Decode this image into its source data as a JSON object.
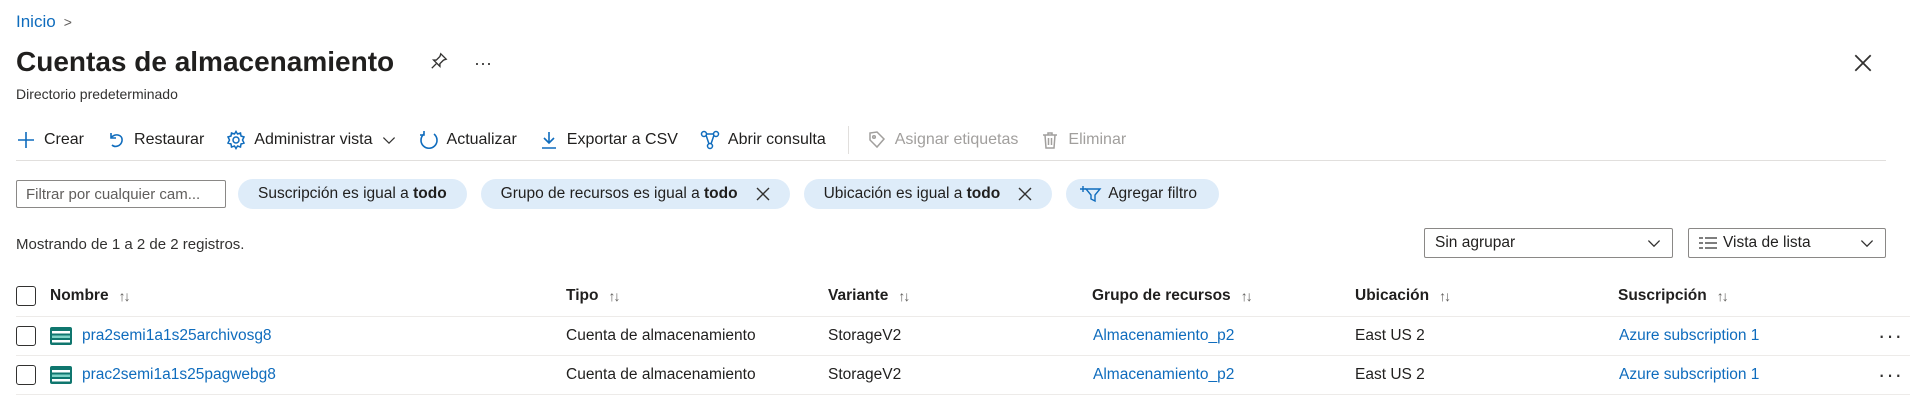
{
  "breadcrumb": {
    "home": "Inicio"
  },
  "page": {
    "title": "Cuentas de almacenamiento",
    "subtitle": "Directorio predeterminado"
  },
  "commands": {
    "crear": "Crear",
    "restaurar": "Restaurar",
    "administrar_vista": "Administrar vista",
    "actualizar": "Actualizar",
    "exportar": "Exportar a CSV",
    "abrir_consulta": "Abrir consulta",
    "asignar_etiquetas": "Asignar etiquetas",
    "eliminar": "Eliminar"
  },
  "filters": {
    "search_placeholder": "Filtrar por cualquier cam...",
    "pills": [
      {
        "prefix": "Suscripción es igual a ",
        "value": "todo"
      },
      {
        "prefix": "Grupo de recursos es igual a ",
        "value": "todo"
      },
      {
        "prefix": "Ubicación es igual a ",
        "value": "todo"
      }
    ],
    "add_filter": "Agregar filtro"
  },
  "records_text": "Mostrando de 1 a 2 de 2 registros.",
  "grouping": {
    "selected": "Sin agrupar"
  },
  "view": {
    "selected": "Vista de lista"
  },
  "table": {
    "columns": [
      "Nombre",
      "Tipo",
      "Variante",
      "Grupo de recursos",
      "Ubicación",
      "Suscripción"
    ],
    "sort_glyph": "↑↓",
    "rows": [
      {
        "name": "pra2semi1a1s25archivosg8",
        "type": "Cuenta de almacenamiento",
        "variant": "StorageV2",
        "resource_group": "Almacenamiento_p2",
        "location": "East US 2",
        "subscription": "Azure subscription 1"
      },
      {
        "name": "prac2semi1a1s25pagwebg8",
        "type": "Cuenta de almacenamiento",
        "variant": "StorageV2",
        "resource_group": "Almacenamiento_p2",
        "location": "East US 2",
        "subscription": "Azure subscription 1"
      }
    ],
    "more_glyph": "···"
  },
  "colors": {
    "accent": "#0f6cbd",
    "pill_bg": "#deecf9",
    "disabled": "#a19f9d"
  }
}
